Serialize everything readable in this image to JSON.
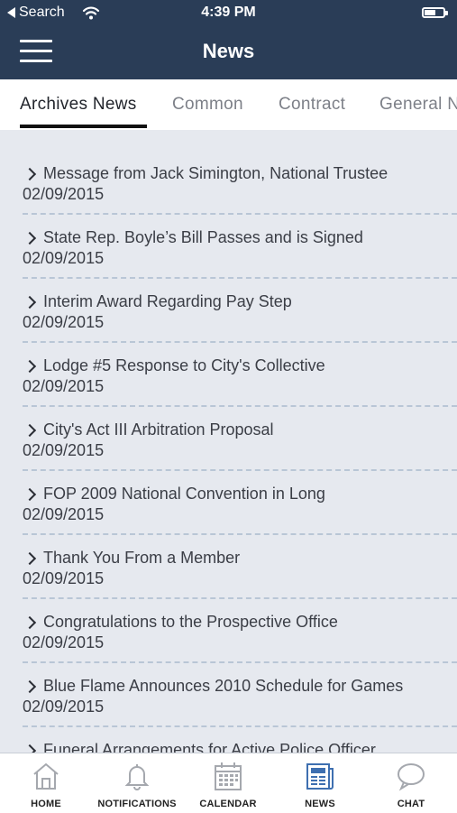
{
  "status_bar": {
    "back_label": "Search",
    "time": "4:39 PM"
  },
  "header": {
    "title": "News"
  },
  "tabs": [
    {
      "label": "Archives News"
    },
    {
      "label": "Common"
    },
    {
      "label": "Contract"
    },
    {
      "label": "General News"
    }
  ],
  "news_items": [
    {
      "title": "Message from Jack Simington, National Trustee",
      "date": "02/09/2015"
    },
    {
      "title": "State Rep. Boyle’s Bill Passes and is Signed",
      "date": "02/09/2015"
    },
    {
      "title": "Interim Award Regarding Pay Step",
      "date": "02/09/2015"
    },
    {
      "title": "Lodge #5 Response to City's Collective",
      "date": "02/09/2015"
    },
    {
      "title": "City's Act III Arbitration Proposal",
      "date": "02/09/2015"
    },
    {
      "title": "FOP 2009 National Convention in Long",
      "date": "02/09/2015"
    },
    {
      "title": "Thank You From a Member",
      "date": "02/09/2015"
    },
    {
      "title": "Congratulations to the Prospective Office",
      "date": "02/09/2015"
    },
    {
      "title": "Blue Flame Announces 2010 Schedule for Games",
      "date": "02/09/2015"
    },
    {
      "title": "Funeral Arrangements for Active Police Officer",
      "date": ""
    }
  ],
  "bottom_nav": {
    "home": "HOME",
    "notifications": "NOTIFICATIONS",
    "calendar": "CALENDAR",
    "news": "NEWS",
    "chat": "CHAT"
  },
  "colors": {
    "header_bg": "#2a3d57",
    "list_bg": "#e6e9ef",
    "active_nav": "#3e6fb0",
    "inactive_nav": "#a5a8ae"
  }
}
